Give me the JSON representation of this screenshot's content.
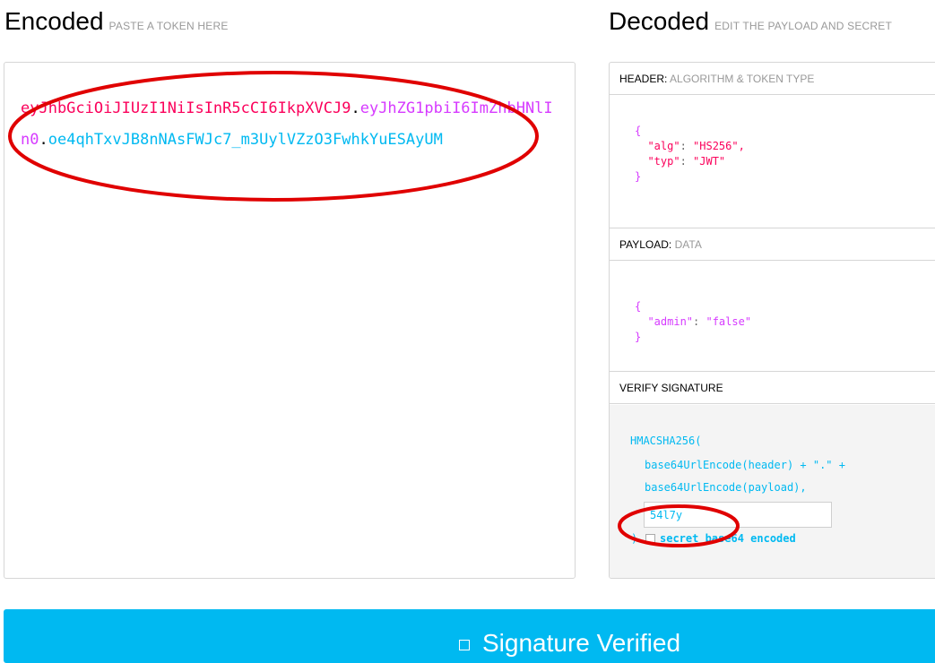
{
  "encoded": {
    "title": "Encoded",
    "subtitle": "PASTE A TOKEN HERE",
    "token_header": "eyJhbGciOiJIUzI1NiIsInR5cCI6IkpXVCJ9",
    "token_payload": "eyJhZG1pbiI6ImZhbHNlIn0",
    "token_signature": "oe4qhTxvJB8nNAsFWJc7_m3UylVZzO3FwhkYuESAyUM",
    "dot": "."
  },
  "decoded": {
    "title": "Decoded",
    "subtitle": "EDIT THE PAYLOAD AND SECRET",
    "header_section": {
      "label": "HEADER:",
      "sub": "ALGORITHM & TOKEN TYPE"
    },
    "header_json": {
      "open": "{",
      "k1": "\"alg\"",
      "v1": "\"HS256\",",
      "k2": "\"typ\"",
      "v2": "\"JWT\"",
      "close": "}"
    },
    "payload_section": {
      "label": "PAYLOAD:",
      "sub": "DATA"
    },
    "payload_json": {
      "open": "{",
      "k1": "\"admin\"",
      "v1": "\"false\"",
      "close": "}"
    },
    "verify_section": {
      "label": "VERIFY SIGNATURE"
    },
    "verify": {
      "line1": "HMACSHA256(",
      "line2": "base64UrlEncode(header) + \".\" +",
      "line3": "base64UrlEncode(payload),",
      "secret_value": "54l7y",
      "close": ")",
      "checkbox_label": "secret base64 encoded"
    }
  },
  "banner": {
    "text": "Signature Verified"
  },
  "colors": {
    "header": "#fb015b",
    "payload": "#d63aff",
    "signature": "#00b9f1",
    "banner": "#00b9f1",
    "annotation": "#e00000"
  },
  "icons": {
    "banner_icon": "checkbox-square-icon"
  }
}
